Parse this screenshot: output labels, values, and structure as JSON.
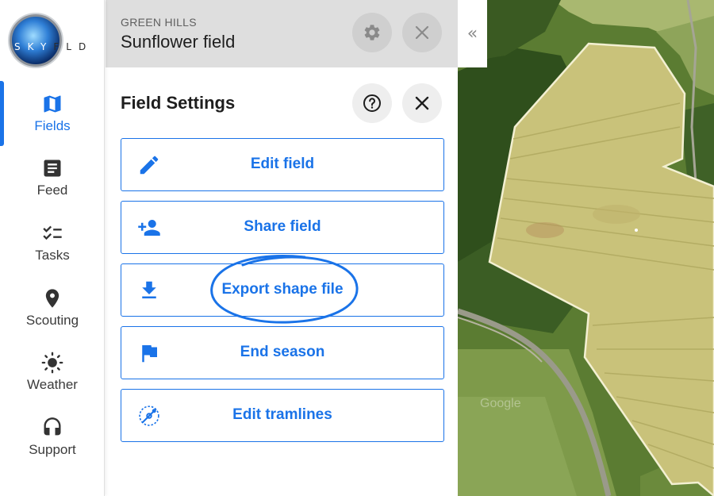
{
  "app": {
    "logo_text_light": "SKY",
    "logo_text_dark": "FLD"
  },
  "nav": {
    "items": [
      {
        "label": "Fields",
        "icon": "map-icon",
        "active": true
      },
      {
        "label": "Feed",
        "icon": "document-icon",
        "active": false
      },
      {
        "label": "Tasks",
        "icon": "checklist-icon",
        "active": false
      },
      {
        "label": "Scouting",
        "icon": "location-pin-icon",
        "active": false
      },
      {
        "label": "Weather",
        "icon": "sun-icon",
        "active": false
      },
      {
        "label": "Support",
        "icon": "headset-icon",
        "active": false
      }
    ]
  },
  "header": {
    "farm_name": "GREEN HILLS",
    "field_name": "Sunflower field",
    "settings_icon": "gear-icon",
    "close_icon": "close-icon"
  },
  "settings": {
    "title": "Field Settings",
    "help_icon": "help-icon",
    "close_icon": "close-icon",
    "actions": [
      {
        "label": "Edit field",
        "icon": "pencil-icon"
      },
      {
        "label": "Share field",
        "icon": "add-person-icon"
      },
      {
        "label": "Export shape file",
        "icon": "download-icon",
        "highlighted": true
      },
      {
        "label": "End season",
        "icon": "flag-icon"
      },
      {
        "label": "Edit tramlines",
        "icon": "tramline-icon"
      }
    ]
  },
  "map": {
    "collapse_glyph": "«",
    "watermark": "Google"
  },
  "colors": {
    "accent": "#1a73e8",
    "header_bg": "#dedede",
    "field_fill": "#c9c27a",
    "field_outline": "#f3f0d2"
  }
}
